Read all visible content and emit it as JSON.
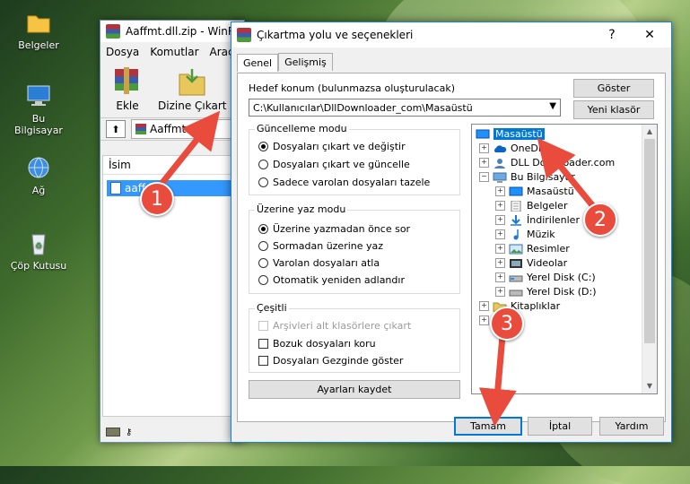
{
  "desktop": {
    "icons": [
      {
        "label": "Belgeler",
        "icon": "folder-icon"
      },
      {
        "label": "Bu Bilgisayar",
        "icon": "computer-icon"
      },
      {
        "label": "Ağ",
        "icon": "network-icon"
      },
      {
        "label": "Çöp Kutusu",
        "icon": "recycle-bin-icon"
      }
    ]
  },
  "winrar": {
    "title": "Aaffmt.dll.zip - WinR",
    "menu": [
      "Dosya",
      "Komutlar",
      "Araçla"
    ],
    "tools": [
      {
        "label": "Ekle",
        "icon": "add-archive-icon"
      },
      {
        "label": "Dizine Çıkart",
        "icon": "extract-to-icon"
      }
    ],
    "path": "Aaffmt.dll.z",
    "column": "İsim",
    "file": "aaffmt"
  },
  "dialog": {
    "title": "Çıkartma yolu ve seçenekleri",
    "help": "?",
    "close": "✕",
    "tabs": [
      "Genel",
      "Gelişmiş"
    ],
    "dest_label": "Hedef konum (bulunmazsa oluşturulacak)",
    "dest_value": "C:\\Kullanıcılar\\DllDownloader_com\\Masaüstü",
    "show_button": "Göster",
    "new_folder_button": "Yeni klasör",
    "update_group": {
      "title": "Güncelleme modu",
      "options": [
        {
          "label": "Dosyaları çıkart ve değiştir",
          "checked": true
        },
        {
          "label": "Dosyaları çıkart ve güncelle",
          "checked": false
        },
        {
          "label": "Sadece varolan dosyaları tazele",
          "checked": false
        }
      ]
    },
    "overwrite_group": {
      "title": "Üzerine yaz modu",
      "options": [
        {
          "label": "Üzerine yazmadan önce sor",
          "checked": true
        },
        {
          "label": "Sormadan üzerine yaz",
          "checked": false
        },
        {
          "label": "Varolan dosyaları atla",
          "checked": false
        },
        {
          "label": "Otomatik yeniden adlandır",
          "checked": false
        }
      ]
    },
    "misc_group": {
      "title": "Çeşitli",
      "options": [
        {
          "label": "Arşivleri alt klasörlere çıkart",
          "checked": false,
          "disabled": true
        },
        {
          "label": "Bozuk dosyaları koru",
          "checked": false
        },
        {
          "label": "Dosyaları Gezginde göster",
          "checked": false
        }
      ]
    },
    "save_settings": "Ayarları kaydet",
    "tree": [
      {
        "label": "Masaüstü",
        "icon": "desktop-icon",
        "selected": true
      },
      {
        "label": "OneDrive",
        "icon": "onedrive-icon"
      },
      {
        "label": "DLL Downloader.com",
        "icon": "user-icon"
      },
      {
        "label": "Bu Bilgisayar",
        "icon": "computer-icon"
      },
      {
        "label": "Masaüstü",
        "icon": "desktop-icon"
      },
      {
        "label": "Belgeler",
        "icon": "documents-icon"
      },
      {
        "label": "İndirilenler",
        "icon": "downloads-icon"
      },
      {
        "label": "Müzik",
        "icon": "music-icon"
      },
      {
        "label": "Resimler",
        "icon": "pictures-icon"
      },
      {
        "label": "Videolar",
        "icon": "videos-icon"
      },
      {
        "label": "Yerel Disk (C:)",
        "icon": "disk-icon"
      },
      {
        "label": "Yerel Disk (D:)",
        "icon": "disk-icon"
      },
      {
        "label": "Kitaplıklar",
        "icon": "libraries-icon"
      },
      {
        "label": "",
        "icon": "folder-icon"
      }
    ],
    "ok": "Tamam",
    "cancel": "İptal",
    "help_button": "Yardım"
  },
  "annotations": {
    "step1": "1",
    "step2": "2",
    "step3": "3",
    "color": "#e94b3c"
  }
}
